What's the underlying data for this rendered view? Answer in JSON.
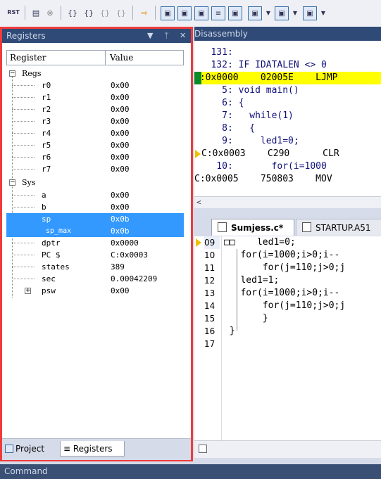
{
  "toolbar": {
    "items": [
      "RST",
      "▤",
      "⊗",
      "{}",
      "{}",
      "{}",
      "{}",
      "⇨",
      "▣",
      "▣",
      "▣",
      "≡",
      "▣",
      "▣",
      "▣",
      "▣"
    ]
  },
  "registers_pane": {
    "title": "Registers",
    "header": {
      "register": "Register",
      "value": "Value"
    },
    "groups": {
      "regs": "Regs",
      "sys": "Sys"
    },
    "rows": [
      {
        "name": "r0",
        "value": "0x00"
      },
      {
        "name": "r1",
        "value": "0x00"
      },
      {
        "name": "r2",
        "value": "0x00"
      },
      {
        "name": "r3",
        "value": "0x00"
      },
      {
        "name": "r4",
        "value": "0x00"
      },
      {
        "name": "r5",
        "value": "0x00"
      },
      {
        "name": "r6",
        "value": "0x00"
      },
      {
        "name": "r7",
        "value": "0x00"
      },
      {
        "name": "a",
        "value": "0x00"
      },
      {
        "name": "b",
        "value": "0x00"
      },
      {
        "name": "sp",
        "value": "0x0b"
      },
      {
        "name": "sp_max",
        "value": "0x0b"
      },
      {
        "name": "dptr",
        "value": "0x0000"
      },
      {
        "name": "PC  $",
        "value": "C:0x0003"
      },
      {
        "name": "states",
        "value": "389"
      },
      {
        "name": "sec",
        "value": "0.00042209"
      },
      {
        "name": "psw",
        "value": "0x00"
      }
    ],
    "bottom_tabs": {
      "project": "Project",
      "registers": "Registers"
    }
  },
  "disassembly": {
    "title": "Disassembly",
    "lines": [
      "   131:",
      "   132: IF IDATALEN <> 0",
      "C:0x0000    02005E    LJMP",
      "     5: void main()",
      "     6: {",
      "     7:   while(1)",
      "     8:   {",
      "     9:     led1=0;",
      "C:0x0003    C290      CLR",
      "    10:       for(i=1000",
      "C:0x0005    750803    MOV"
    ]
  },
  "source_tabs": {
    "active": "Sumjess.c*",
    "other": "STARTUP.A51"
  },
  "source": {
    "line_numbers": [
      "09",
      "10",
      "11",
      "12",
      "13",
      "14",
      "15",
      "16",
      "17"
    ],
    "lines": [
      "□□    led1=0;",
      "   for(i=1000;i>0;i--",
      "       for(j=110;j>0;j",
      "   led1=1;",
      "   for(i=1000;i>0;i--",
      "       for(j=110;j>0;j",
      "       }",
      " }",
      ""
    ]
  },
  "command_bar": {
    "title": "Command"
  }
}
